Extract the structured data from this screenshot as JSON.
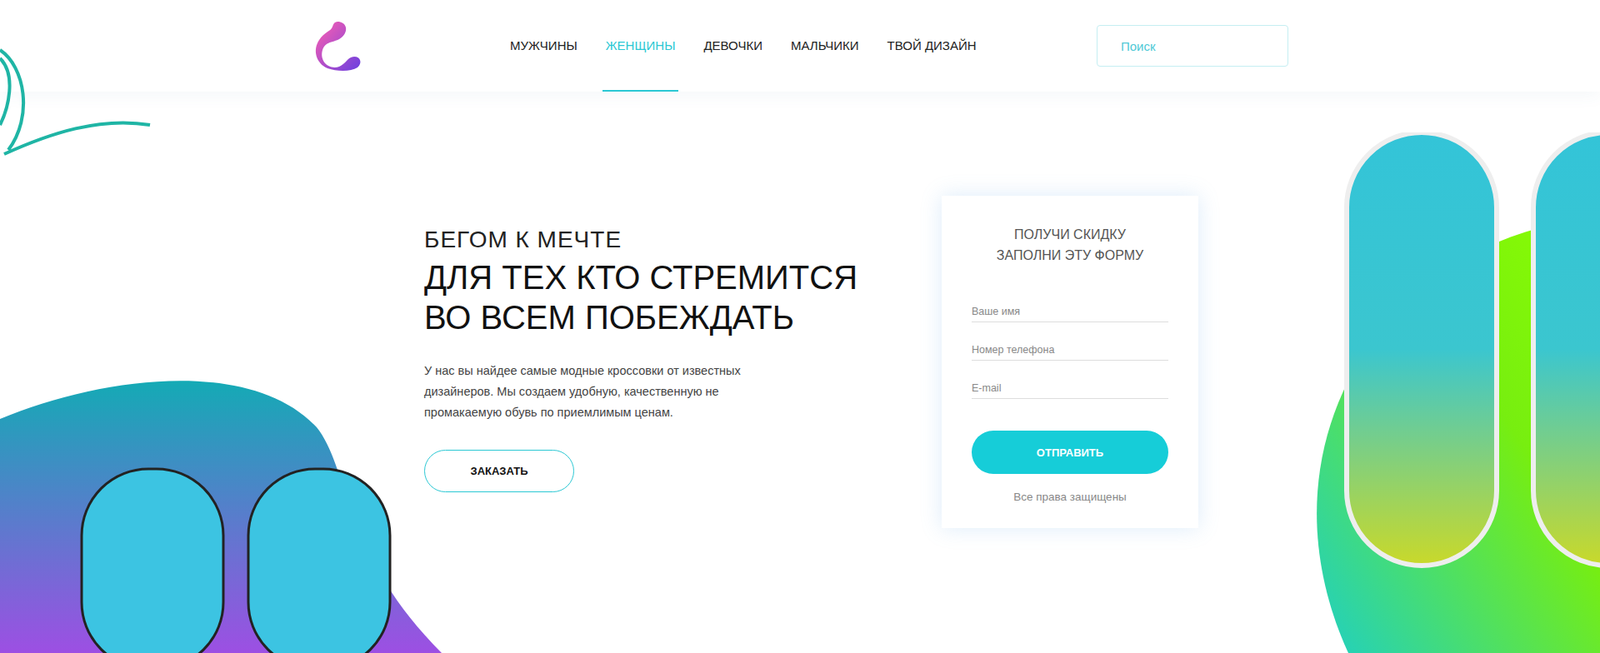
{
  "nav": {
    "items": [
      {
        "label": "МУЖЧИНЫ",
        "selected": false
      },
      {
        "label": "ЖЕНЩИНЫ",
        "selected": true
      },
      {
        "label": "ДЕВОЧКИ",
        "selected": false
      },
      {
        "label": "МАЛЬЧИКИ",
        "selected": false
      },
      {
        "label": "ТВОЙ ДИЗАЙН",
        "selected": false
      }
    ]
  },
  "search": {
    "placeholder": "Поиск"
  },
  "hero": {
    "kicker": "БЕГОМ К МЕЧТЕ",
    "title_lines": [
      "ДЛЯ ТЕХ КТО СТРЕМИТСЯ",
      "ВО ВСЕМ ПОБЕЖДАТЬ"
    ],
    "text": "У нас вы найдее самые модные кроссовки от известных дизайнеров. Мы создаем удобную, качественную не промакаемую обувь по приемлимым ценам.",
    "button": "ЗАКАЗАТЬ"
  },
  "form": {
    "title_lines": [
      "ПОЛУЧИ СКИДКУ",
      "ЗАПОЛНИ ЭТУ ФОРМУ"
    ],
    "fields": [
      {
        "placeholder": "Ваше имя"
      },
      {
        "placeholder": "Номер телефона"
      },
      {
        "placeholder": "E-mail"
      }
    ],
    "submit": "ОТПРАВИТЬ",
    "footer": "Все права защищены"
  }
}
